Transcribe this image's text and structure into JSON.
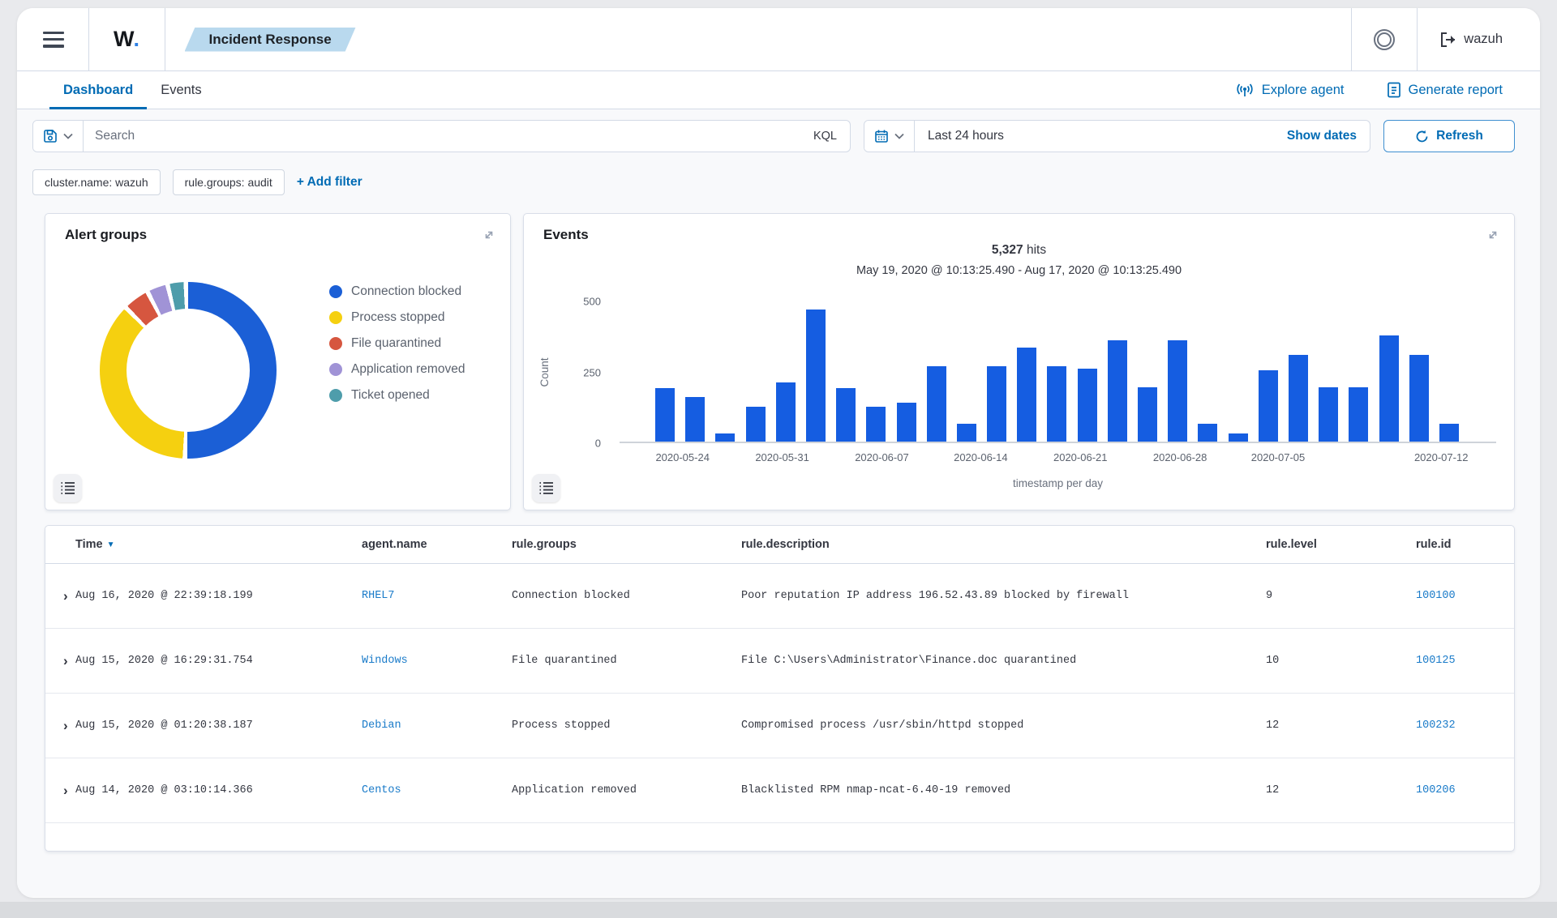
{
  "topbar": {
    "logo_w": "W",
    "logo_dot": ".",
    "badge": "Incident Response",
    "account": "wazuh"
  },
  "tabs": {
    "items": [
      {
        "label": "Dashboard",
        "active": true
      },
      {
        "label": "Events",
        "active": false
      }
    ],
    "actions": [
      {
        "label": "Explore agent"
      },
      {
        "label": "Generate report"
      }
    ]
  },
  "search": {
    "placeholder": "Search",
    "kql": "KQL",
    "time_range": "Last 24 hours",
    "show_dates": "Show dates",
    "refresh": "Refresh"
  },
  "filters": {
    "pills": [
      "cluster.name: wazuh",
      "rule.groups: audit"
    ],
    "add": "+ Add filter"
  },
  "panels": {
    "alert_groups": {
      "title": "Alert groups"
    },
    "events": {
      "title": "Events",
      "hits_value": "5,327",
      "hits_label": "hits",
      "date_range": "May 19, 2020 @ 10:13:25.490 - Aug 17, 2020 @ 10:13:25.490"
    }
  },
  "chart_data": [
    {
      "type": "pie",
      "title": "Alert groups",
      "donut": true,
      "legend_position": "right",
      "slices": [
        {
          "label": "Connection blocked",
          "percent": 50,
          "color": "#1b5fd6"
        },
        {
          "label": "Process stopped",
          "percent": 36,
          "color": "#f5d010"
        },
        {
          "label": "File quarantined",
          "percent": 4,
          "color": "#d6563f"
        },
        {
          "label": "Application removed",
          "percent": 3,
          "color": "#a093d6"
        },
        {
          "label": "Ticket opened",
          "percent": 2.5,
          "color": "#4e9dab"
        }
      ]
    },
    {
      "type": "bar",
      "title": "Events",
      "hits": "5,327 hits",
      "subtitle": "May 19, 2020 @ 10:13:25.490 - Aug 17, 2020 @ 10:13:25.490",
      "values": [
        190,
        160,
        30,
        125,
        210,
        470,
        190,
        125,
        140,
        270,
        65,
        270,
        335,
        270,
        260,
        360,
        195,
        360,
        65,
        30,
        255,
        310,
        195,
        195,
        380,
        310,
        65
      ],
      "bar_color": "#155de1",
      "ylabel": "Count",
      "xlabel": "timestamp per day",
      "ylim": [
        0,
        500
      ],
      "yticks": [
        0,
        250,
        500
      ],
      "grid": false,
      "xticks": [
        {
          "label": "2020-05-24",
          "pos": 3.4
        },
        {
          "label": "2020-05-31",
          "pos": 15.8
        },
        {
          "label": "2020-06-07",
          "pos": 28.2
        },
        {
          "label": "2020-06-14",
          "pos": 40.5
        },
        {
          "label": "2020-06-21",
          "pos": 52.9
        },
        {
          "label": "2020-06-28",
          "pos": 65.3
        },
        {
          "label": "2020-07-05",
          "pos": 77.5
        },
        {
          "label": "2020-07-12",
          "pos": 97.8
        }
      ]
    }
  ],
  "table": {
    "columns": [
      "Time",
      "agent.name",
      "rule.groups",
      "rule.description",
      "rule.level",
      "rule.id"
    ],
    "rows": [
      {
        "time": "Aug 16, 2020 @ 22:39:18.199",
        "agent": "RHEL7",
        "groups": "Connection blocked",
        "description": "Poor reputation IP address 196.52.43.89 blocked by firewall",
        "level": "9",
        "id": "100100"
      },
      {
        "time": "Aug 15, 2020 @ 16:29:31.754",
        "agent": "Windows",
        "groups": "File quarantined",
        "description": "File C:\\Users\\Administrator\\Finance.doc quarantined",
        "level": "10",
        "id": "100125"
      },
      {
        "time": "Aug 15, 2020 @ 01:20:38.187",
        "agent": "Debian",
        "groups": "Process stopped",
        "description": "Compromised process /usr/sbin/httpd stopped",
        "level": "12",
        "id": "100232"
      },
      {
        "time": "Aug 14, 2020 @ 03:10:14.366",
        "agent": "Centos",
        "groups": "Application removed",
        "description": "Blacklisted RPM nmap-ncat-6.40-19 removed",
        "level": "12",
        "id": "100206"
      }
    ]
  },
  "colors": {
    "accent": "#006BB4",
    "bar_blue": "#155de1",
    "badge_bg": "#b9d9ee",
    "border": "#d3dae6"
  }
}
